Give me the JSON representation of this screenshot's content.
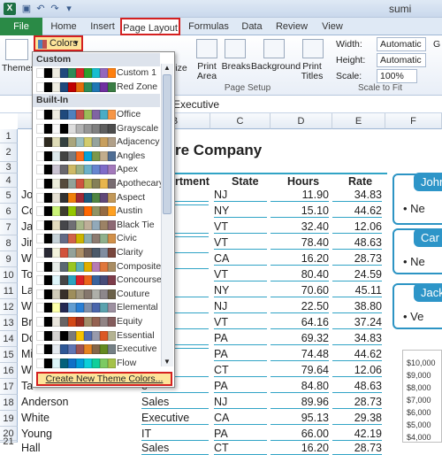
{
  "title": "sumi",
  "tabs": [
    "File",
    "Home",
    "Insert",
    "Page Layout",
    "Formulas",
    "Data",
    "Review",
    "View"
  ],
  "ribbon": {
    "themes_label": "Themes",
    "colors_label": "Colors",
    "size_label": "ize",
    "print_area_label": "Print Area",
    "breaks_label": "Breaks",
    "background_label": "Background",
    "print_titles_label": "Print Titles",
    "page_setup_group": "Page Setup",
    "width_label": "Width:",
    "width_value": "Automatic",
    "height_label": "Height:",
    "height_value": "Automatic",
    "scale_label": "Scale:",
    "scale_value": "100%",
    "scale_group": "Scale to Fit",
    "grid_partial": "G"
  },
  "formula_bar": {
    "value": "Executive"
  },
  "columns": [
    "B",
    "C",
    "D",
    "E",
    "F"
  ],
  "rows": [
    "1",
    "2",
    "3",
    "4",
    "5",
    "6",
    "7",
    "8",
    "9",
    "10",
    "11",
    "12",
    "13",
    "14",
    "15",
    "16",
    "17",
    "18",
    "19",
    "20",
    "21"
  ],
  "sheet": {
    "company": "re Company",
    "headers": [
      "rtment",
      "State",
      "Hours",
      "Rate"
    ],
    "rows": [
      {
        "a": "Jo",
        "b": "e",
        "c": "NJ",
        "d": "11.90",
        "e": "34.83"
      },
      {
        "a": "Co",
        "b": "",
        "c": "NY",
        "d": "15.10",
        "e": "44.62"
      },
      {
        "a": "Ja",
        "b": "ve",
        "c": "VT",
        "d": "32.40",
        "e": "12.06"
      },
      {
        "a": "Jin",
        "b": "",
        "c": "VT",
        "d": "78.40",
        "e": "48.63"
      },
      {
        "a": "Wi",
        "b": "",
        "c": "CA",
        "d": "16.20",
        "e": "28.73"
      },
      {
        "a": "To",
        "b": "",
        "c": "VT",
        "d": "80.40",
        "e": "24.59"
      },
      {
        "a": "La",
        "b": "ing",
        "c": "NY",
        "d": "70.60",
        "e": "45.11"
      },
      {
        "a": "Wi",
        "b": "cs",
        "c": "NJ",
        "d": "22.50",
        "e": "38.80"
      },
      {
        "a": "Br",
        "b": "cs",
        "c": "VT",
        "d": "64.16",
        "e": "37.24"
      },
      {
        "a": "Do",
        "b": "e",
        "c": "PA",
        "d": "69.32",
        "e": "34.83"
      },
      {
        "a": "Mi",
        "b": "",
        "c": "PA",
        "d": "74.48",
        "e": "44.62"
      },
      {
        "a": "Wi",
        "b": "e",
        "c": "CT",
        "d": "79.64",
        "e": "12.06"
      },
      {
        "a": "Ta",
        "b": "e",
        "c": "PA",
        "d": "84.80",
        "e": "48.63"
      },
      {
        "a": "Anderson",
        "b": "Sales",
        "c": "NJ",
        "d": "89.96",
        "e": "28.73"
      },
      {
        "a": "White",
        "b": "Executive",
        "c": "CA",
        "d": "95.13",
        "e": "29.38"
      },
      {
        "a": "Young",
        "b": "IT",
        "c": "PA",
        "d": "66.00",
        "e": "42.19"
      },
      {
        "a": "Hall",
        "b": "Sales",
        "c": "CT",
        "d": "16.20",
        "e": "28.73"
      }
    ]
  },
  "org": [
    {
      "head": "John",
      "item": "Ne"
    },
    {
      "head": "Car",
      "item": "Ne"
    },
    {
      "head": "Jack",
      "item": "Ve"
    }
  ],
  "chart_ticks": [
    "$10,000",
    "$9,000",
    "$8,000",
    "$7,000",
    "$6,000",
    "$5,000",
    "$4,000"
  ],
  "dropdown": {
    "custom_section": "Custom",
    "builtin_section": "Built-In",
    "custom": [
      {
        "name": "Custom 1",
        "colors": [
          "#ffffff",
          "#000000",
          "#eeece1",
          "#1f497d",
          "#2e8b57",
          "#d62728",
          "#2ca02c",
          "#17becf",
          "#9467bd",
          "#ff7f0e"
        ]
      },
      {
        "name": "Red Zone",
        "colors": [
          "#ffffff",
          "#000000",
          "#eeece1",
          "#1f497d",
          "#c00000",
          "#e46c0a",
          "#2e8b57",
          "#1f77b4",
          "#7030a0",
          "#3a7d44"
        ]
      }
    ],
    "builtin": [
      {
        "name": "Office",
        "colors": [
          "#ffffff",
          "#000000",
          "#eeece1",
          "#1f497d",
          "#4f81bd",
          "#c0504d",
          "#9bbb59",
          "#8064a2",
          "#4bacc6",
          "#f79646"
        ]
      },
      {
        "name": "Grayscale",
        "colors": [
          "#ffffff",
          "#000000",
          "#f8f8f8",
          "#000000",
          "#dddddd",
          "#b2b2b2",
          "#969696",
          "#808080",
          "#5f5f5f",
          "#4d4d4d"
        ]
      },
      {
        "name": "Adjacency",
        "colors": [
          "#ffffff",
          "#2f2b20",
          "#dfdcb7",
          "#344140",
          "#a9a57c",
          "#9cbebd",
          "#d2cb6c",
          "#95a39d",
          "#c89f5d",
          "#b1a089"
        ]
      },
      {
        "name": "Angles",
        "colors": [
          "#ffffff",
          "#000000",
          "#dde9ec",
          "#434342",
          "#797b7e",
          "#f96a1b",
          "#08a1d9",
          "#7c984a",
          "#c2ad8d",
          "#506e94"
        ]
      },
      {
        "name": "Apex",
        "colors": [
          "#ffffff",
          "#000000",
          "#c9c2d1",
          "#69676d",
          "#ceb966",
          "#9cb084",
          "#6bb1c9",
          "#6585cf",
          "#7e6bc9",
          "#a379bb"
        ]
      },
      {
        "name": "Apothecary",
        "colors": [
          "#ffffff",
          "#000000",
          "#eceddb",
          "#564b3c",
          "#93a299",
          "#cf543f",
          "#b5ae53",
          "#848058",
          "#e8b54d",
          "#786c71"
        ]
      },
      {
        "name": "Aspect",
        "colors": [
          "#ffffff",
          "#000000",
          "#e3ded1",
          "#323232",
          "#f07f09",
          "#9f2936",
          "#1b587c",
          "#4e8542",
          "#604878",
          "#c19859"
        ]
      },
      {
        "name": "Austin",
        "colors": [
          "#ffffff",
          "#000000",
          "#caf278",
          "#3e3d2d",
          "#94c600",
          "#71685a",
          "#ff6700",
          "#909465",
          "#956b43",
          "#fea022"
        ]
      },
      {
        "name": "Black Tie",
        "colors": [
          "#ffffff",
          "#000000",
          "#e3dcbf",
          "#46464a",
          "#6f6f74",
          "#a7b789",
          "#beae98",
          "#92a9b9",
          "#9c8265",
          "#8d6974"
        ]
      },
      {
        "name": "Civic",
        "colors": [
          "#ffffff",
          "#000000",
          "#c5d1d7",
          "#646b86",
          "#d16349",
          "#ccb400",
          "#8cadae",
          "#8c7b70",
          "#8fb08c",
          "#d19049"
        ]
      },
      {
        "name": "Clarity",
        "colors": [
          "#ffffff",
          "#292934",
          "#f3f2dc",
          "#d2533c",
          "#93a299",
          "#ad8f67",
          "#726056",
          "#4c5a6a",
          "#808da0",
          "#79463d"
        ]
      },
      {
        "name": "Composite",
        "colors": [
          "#ffffff",
          "#000000",
          "#e7ece8",
          "#5b6973",
          "#98c723",
          "#59b0b9",
          "#deae00",
          "#b77bb4",
          "#e0773c",
          "#a98d63"
        ]
      },
      {
        "name": "Concourse",
        "colors": [
          "#ffffff",
          "#000000",
          "#def5fa",
          "#464646",
          "#2da2bf",
          "#da1f28",
          "#eb641b",
          "#39639d",
          "#474b78",
          "#7d3c4a"
        ]
      },
      {
        "name": "Couture",
        "colors": [
          "#ffffff",
          "#000000",
          "#d0ccb9",
          "#37302a",
          "#9e8e5c",
          "#a09781",
          "#85776d",
          "#aeafa9",
          "#8d878b",
          "#6b6149"
        ]
      },
      {
        "name": "Elemental",
        "colors": [
          "#ffffff",
          "#000000",
          "#fcffa8",
          "#242852",
          "#629dd1",
          "#297fd5",
          "#7f8fa9",
          "#4a66ac",
          "#5aa2ae",
          "#9d90a0"
        ]
      },
      {
        "name": "Equity",
        "colors": [
          "#ffffff",
          "#000000",
          "#e9e5dc",
          "#696464",
          "#d34817",
          "#9b2d1f",
          "#a28e6a",
          "#956251",
          "#918485",
          "#855d5d"
        ]
      },
      {
        "name": "Essential",
        "colors": [
          "#ffffff",
          "#000000",
          "#d4d2d0",
          "#000000",
          "#7a7a7a",
          "#f5c201",
          "#526db0",
          "#989aac",
          "#dc5924",
          "#b4b392"
        ]
      },
      {
        "name": "Executive",
        "colors": [
          "#ffffff",
          "#000000",
          "#e4e9ef",
          "#2f5897",
          "#6076b4",
          "#9c5252",
          "#e68422",
          "#846648",
          "#63891f",
          "#758085"
        ]
      },
      {
        "name": "Flow",
        "colors": [
          "#ffffff",
          "#000000",
          "#dbf5f9",
          "#04617b",
          "#0f6fc6",
          "#009dd9",
          "#0bd0d9",
          "#10cf9b",
          "#7cca62",
          "#a5c249"
        ]
      }
    ],
    "create_label": "Create New Theme Colors..."
  }
}
